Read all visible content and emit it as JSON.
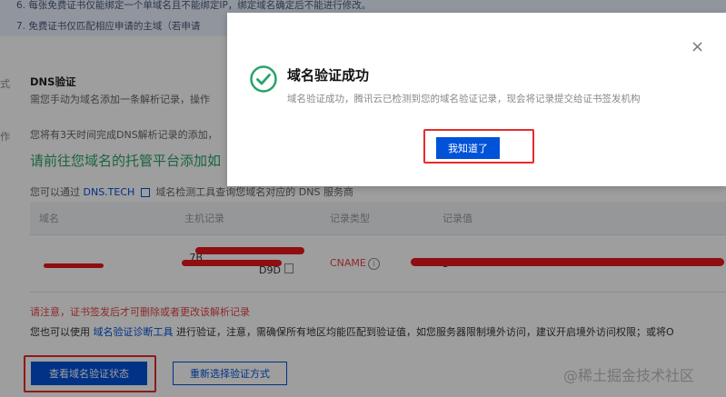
{
  "banner": {
    "line1": "6. 每张免费证书仅能绑定一个单域名且不能绑定IP，绑定域名确定后不能进行修改。",
    "line2": "7. 免费证书仅匹配相应申请的主域（若申请"
  },
  "side": {
    "label1": "式",
    "label2": "作"
  },
  "dns": {
    "title": "DNS验证",
    "desc": "需您手动为域名添加一条解析记录，操作",
    "deadline": "您将有3天时间完成DNS解析记录的添加，",
    "green": "请前往您域名的托管平台添加如",
    "query_pre": "您可以通过",
    "query_link": "DNS.TECH",
    "query_post": "域名检测工具查询您域名对应的 DNS 服务商"
  },
  "table": {
    "headers": [
      "域名",
      "主机记录",
      "记录类型",
      "记录值"
    ],
    "row": {
      "domain": "",
      "host_top": "_7B",
      "host_bottom": "D9D",
      "type": "CNAME",
      "value": "3"
    }
  },
  "warning": "请注意，证书签发后才可删除或者更改该解析记录",
  "tip": {
    "pre": "您也可以使用",
    "link": "域名验证诊断工具",
    "post": "进行验证，注意，需确保所有地区均能匹配到验证值，如您服务器限制境外访问，建议开启境外访问权限；或将O"
  },
  "buttons": {
    "check": "查看域名验证状态",
    "reselect": "重新选择验证方式"
  },
  "watermark": "@稀土掘金技术社区",
  "modal": {
    "title": "域名验证成功",
    "desc": "域名验证成功，腾讯云已检测到您的域名验证记录，现会将记录提交给证书签发机构",
    "confirm": "我知道了",
    "close": "×"
  },
  "colors": {
    "primary": "#0052d9",
    "success": "#29a26b",
    "highlight": "#e62b2b"
  }
}
